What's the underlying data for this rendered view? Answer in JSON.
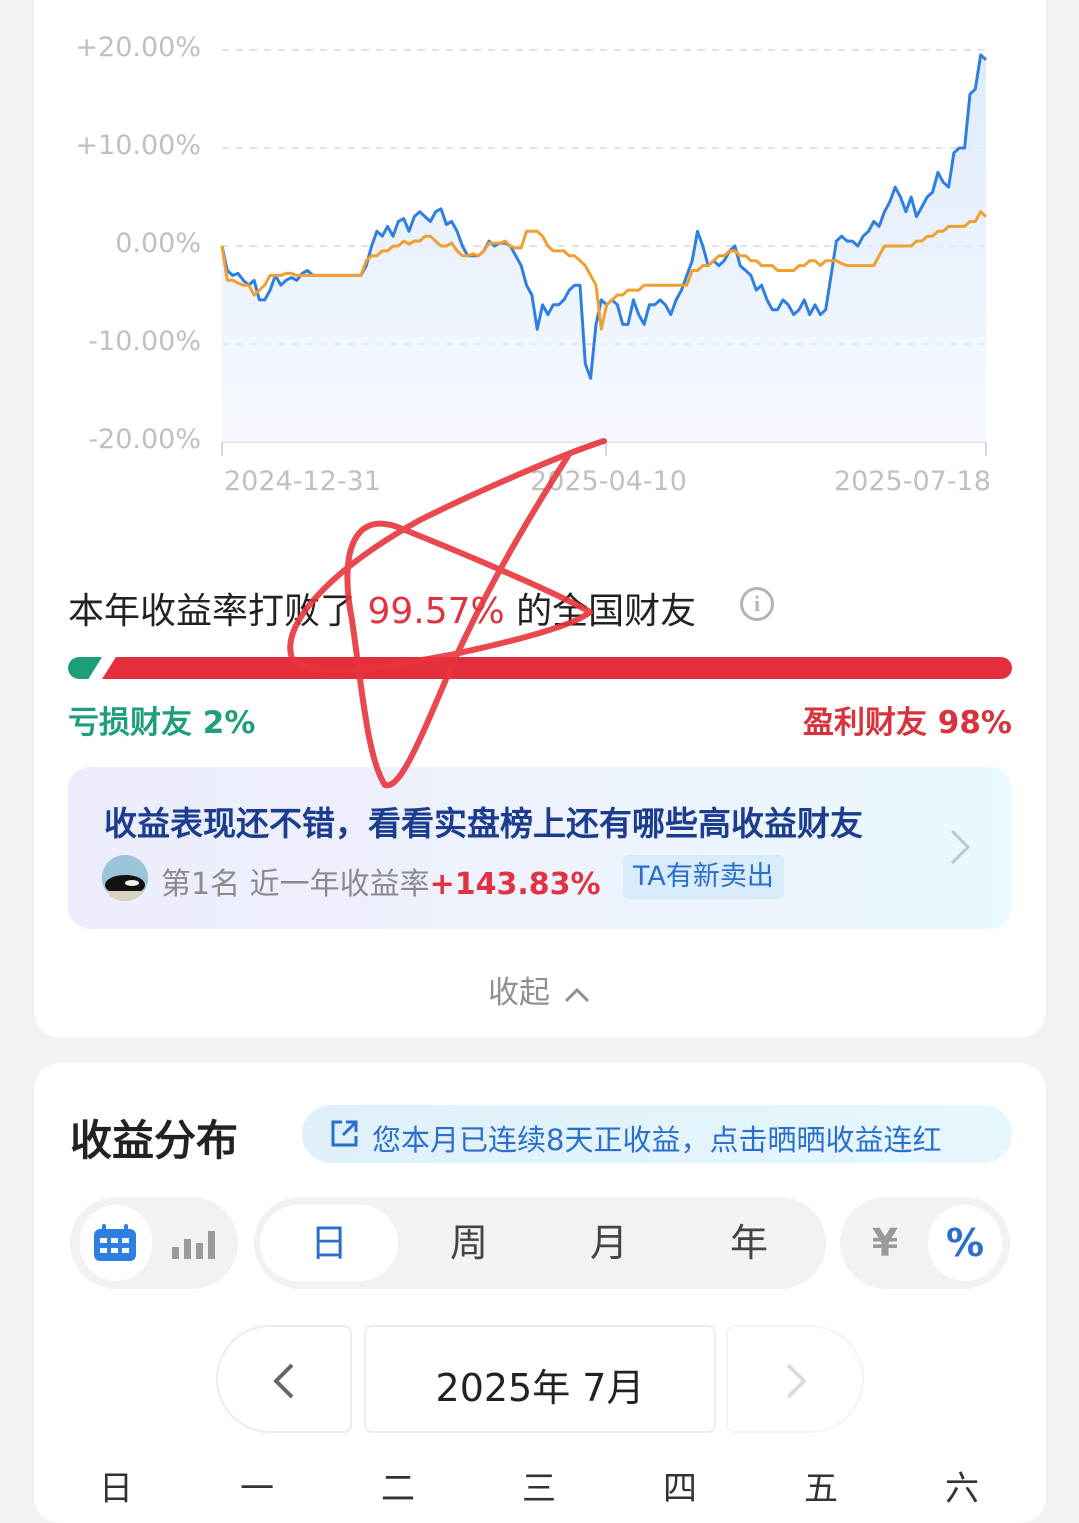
{
  "chart_data": {
    "type": "line",
    "x_ticks": [
      "2024-12-31",
      "2025-04-10",
      "2025-07-18"
    ],
    "y_ticks": [
      "+20.00%",
      "+10.00%",
      "0.00%",
      "-10.00%",
      "-20.00%"
    ],
    "ylim": [
      -20,
      20
    ],
    "grid": true,
    "series": [
      {
        "color": "#2f7fe0",
        "fill": true,
        "values": [
          0.0,
          -2.5,
          -3.0,
          -2.8,
          -3.5,
          -4.0,
          -3.5,
          -5.5,
          -5.5,
          -4.5,
          -3.0,
          -4.0,
          -3.5,
          -3.2,
          -3.5,
          -2.8,
          -2.5,
          -3.0,
          -3.0,
          -3.0,
          -3.0,
          -3.0,
          -3.0,
          -3.0,
          -3.0,
          -3.0,
          -3.0,
          -2.0,
          0.0,
          1.5,
          1.0,
          2.0,
          1.0,
          2.5,
          2.8,
          1.5,
          3.0,
          3.5,
          3.0,
          2.5,
          3.5,
          3.8,
          2.2,
          2.5,
          1.5,
          0.0,
          -1.0,
          -1.0,
          -1.0,
          -0.5,
          0.5,
          0.0,
          0.3,
          0.3,
          0.0,
          -1.0,
          -2.0,
          -4.0,
          -5.0,
          -8.5,
          -6.0,
          -7.0,
          -6.0,
          -6.0,
          -5.5,
          -4.5,
          -4.0,
          -4.0,
          -12.0,
          -13.5,
          -8.0,
          -5.5,
          -6.0,
          -5.5,
          -6.0,
          -8.0,
          -8.0,
          -5.5,
          -7.0,
          -8.0,
          -6.0,
          -6.0,
          -5.5,
          -6.0,
          -7.0,
          -5.5,
          -4.5,
          -3.0,
          -1.5,
          1.5,
          0.0,
          -2.0,
          -1.5,
          -2.0,
          -1.5,
          -0.5,
          0.0,
          -2.0,
          -2.5,
          -3.0,
          -4.5,
          -4.0,
          -5.5,
          -6.5,
          -6.5,
          -5.5,
          -6.0,
          -7.0,
          -6.5,
          -5.5,
          -7.0,
          -6.0,
          -7.0,
          -6.5,
          -3.0,
          0.5,
          1.0,
          0.5,
          0.5,
          0.0,
          1.0,
          1.5,
          2.5,
          2.0,
          3.5,
          4.5,
          6.0,
          5.0,
          3.5,
          5.0,
          3.0,
          4.0,
          5.0,
          5.5,
          7.5,
          6.5,
          6.0,
          9.5,
          10.0,
          10.0,
          15.5,
          16.0,
          19.5,
          19.0
        ]
      },
      {
        "color": "#f0a030",
        "fill": false,
        "values": [
          0.0,
          -3.5,
          -3.5,
          -3.8,
          -4.0,
          -4.0,
          -5.0,
          -4.5,
          -4.0,
          -3.0,
          -3.0,
          -3.0,
          -2.8,
          -2.8,
          -3.0,
          -3.0,
          -3.0,
          -3.0,
          -3.0,
          -3.0,
          -3.0,
          -3.0,
          -3.0,
          -3.0,
          -3.0,
          -3.0,
          -3.0,
          -1.5,
          -1.0,
          -1.0,
          -0.5,
          -0.5,
          0.0,
          0.0,
          0.5,
          0.2,
          0.5,
          0.5,
          1.0,
          1.0,
          0.5,
          0.0,
          0.0,
          0.3,
          -0.5,
          -1.0,
          -1.0,
          -0.8,
          -1.0,
          -0.5,
          0.3,
          0.3,
          0.3,
          0.5,
          0.0,
          -0.2,
          -0.2,
          1.5,
          1.5,
          1.5,
          1.0,
          0.0,
          -0.5,
          -0.5,
          -0.5,
          -1.0,
          -1.0,
          -1.5,
          -2.0,
          -3.0,
          -4.0,
          -8.5,
          -6.0,
          -5.5,
          -5.0,
          -5.0,
          -4.5,
          -4.5,
          -4.5,
          -4.0,
          -4.0,
          -4.0,
          -4.0,
          -4.0,
          -4.0,
          -4.0,
          -4.0,
          -4.0,
          -2.5,
          -2.5,
          -2.0,
          -2.0,
          -1.5,
          -1.0,
          -1.0,
          -0.5,
          -0.5,
          -1.0,
          -1.0,
          -1.5,
          -1.5,
          -2.0,
          -2.0,
          -2.0,
          -2.5,
          -2.5,
          -2.5,
          -2.5,
          -2.0,
          -2.0,
          -1.5,
          -1.5,
          -2.0,
          -1.5,
          -1.5,
          -1.5,
          -1.8,
          -2.0,
          -2.0,
          -2.0,
          -2.0,
          -2.0,
          -2.0,
          -1.0,
          0.0,
          0.0,
          0.0,
          0.0,
          0.0,
          0.0,
          0.5,
          0.5,
          1.0,
          1.0,
          1.5,
          1.5,
          2.0,
          2.0,
          2.0,
          2.0,
          2.5,
          2.5,
          3.5,
          3.0
        ]
      }
    ]
  },
  "rank": {
    "prefix": "本年收益率打败了 ",
    "percent": "99.57%",
    "suffix": " 的全国财友",
    "loss_label": "亏损财友 2%",
    "gain_label": "盈利财友 98%",
    "loss_share": 0.02,
    "gain_share": 0.98,
    "loss_color": "#1e9e7a",
    "gain_color": "#e52e3c"
  },
  "promo": {
    "title": "收益表现还不错，看看实盘榜上还有哪些高收益财友",
    "rank_text": "第1名  近一年收益率",
    "yield": "+143.83%",
    "tag": "TA有新卖出"
  },
  "collapse_label": "收起",
  "distribution": {
    "title": "收益分布",
    "streak": "您本月已连续8天正收益，点击晒晒收益连红",
    "periods": [
      "日",
      "周",
      "月",
      "年"
    ],
    "period_selected": "日",
    "units": [
      "¥",
      "%"
    ],
    "unit_selected": "%",
    "month_label": "2025年 7月",
    "weekdays": [
      "日",
      "一",
      "二",
      "三",
      "四",
      "五",
      "六"
    ]
  },
  "colors": {
    "accent_blue": "#2a6fc9",
    "chart_blue": "#2f7fe0",
    "chart_orange": "#f0a030",
    "annotation_red": "#e8343c"
  }
}
